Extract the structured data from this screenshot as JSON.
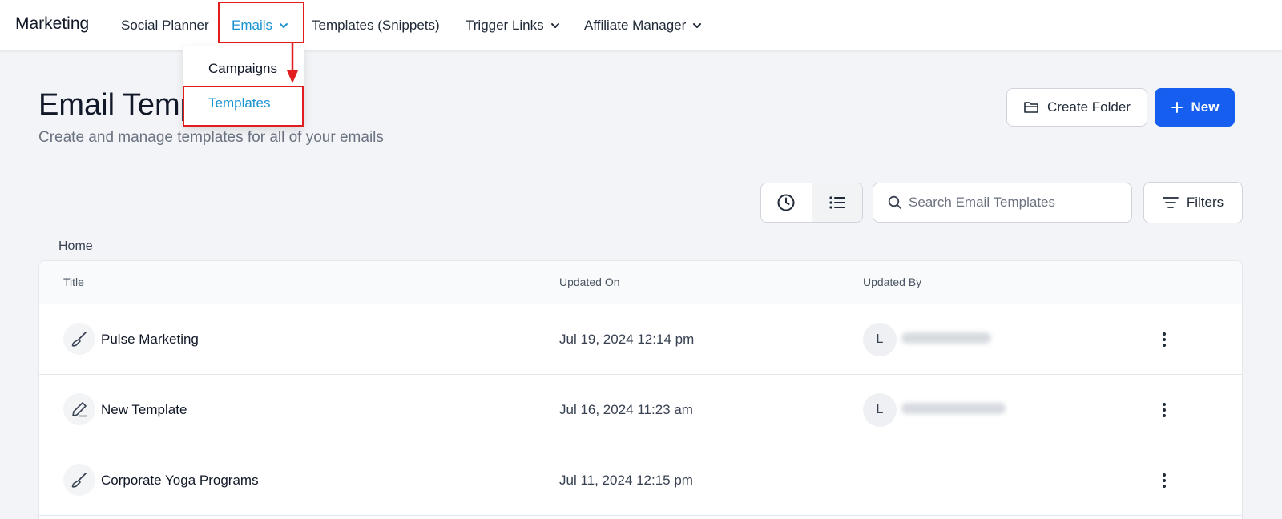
{
  "nav": {
    "brand": "Marketing",
    "items": [
      {
        "label": "Social Planner"
      },
      {
        "label": "Emails"
      },
      {
        "label": "Templates (Snippets)"
      },
      {
        "label": "Trigger Links"
      },
      {
        "label": "Affiliate Manager"
      }
    ],
    "dropdown": {
      "items": [
        {
          "label": "Campaigns"
        },
        {
          "label": "Templates"
        }
      ]
    }
  },
  "header": {
    "title": "Email Templates",
    "subtitle": "Create and manage templates for all of your emails",
    "create_folder_label": "Create Folder",
    "new_label": "New"
  },
  "toolbar": {
    "search_placeholder": "Search Email Templates",
    "filters_label": "Filters"
  },
  "breadcrumb": "Home",
  "table": {
    "columns": [
      "Title",
      "Updated On",
      "Updated By"
    ],
    "rows": [
      {
        "title": "Pulse Marketing",
        "updated_on": "Jul 19, 2024 12:14 pm",
        "avatar_initial": "L",
        "icon": "paintbrush-icon"
      },
      {
        "title": "New Template",
        "updated_on": "Jul 16, 2024 11:23 am",
        "avatar_initial": "L",
        "icon": "pen-icon"
      },
      {
        "title": "Corporate Yoga Programs",
        "updated_on": "Jul 11, 2024 12:15 pm",
        "avatar_initial": "",
        "icon": "paintbrush-icon"
      }
    ]
  },
  "colors": {
    "accent": "#1a93d1",
    "primary_button": "#155eef",
    "highlight": "#e11d1d"
  }
}
